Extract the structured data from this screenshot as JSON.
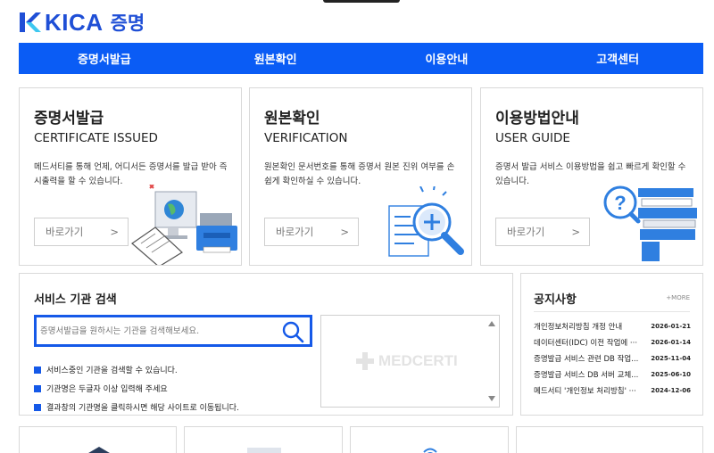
{
  "header": {
    "logo_text": "KICA",
    "logo_kor": "증명"
  },
  "nav": [
    {
      "label": "증명서발급"
    },
    {
      "label": "원본확인"
    },
    {
      "label": "이용안내"
    },
    {
      "label": "고객센터"
    }
  ],
  "cards": [
    {
      "title": "증명서발급",
      "subtitle": "CERTIFICATE ISSUED",
      "desc": "메드서티를 통해 언제, 어디서든 증명서를 발급 받아 즉시출력을 할 수 있습니다.",
      "button": "바로가기",
      "arrow": ">"
    },
    {
      "title": "원본확인",
      "subtitle": "VERIFICATION",
      "desc": "원본확인 문서번호를 통해 증명서 원본 진위 여부를 손쉽게 확인하실 수 있습니다.",
      "button": "바로가기",
      "arrow": ">"
    },
    {
      "title": "이용방법안내",
      "subtitle": "USER GUIDE",
      "desc": "증명서 발급 서비스 이용방법을 쉽고 빠르게 확인할 수 있습니다.",
      "button": "바로가기",
      "arrow": ">"
    }
  ],
  "search": {
    "title": "서비스 기관 검색",
    "placeholder": "증명서발급을 원하시는 기관을 검색해보세요.",
    "bullets": [
      "서비스중인 기관을 검색할 수 있습니다.",
      "기관명은 두글자 이상 입력해 주세요",
      "결과창의 기관명을 클릭하시면 해당 사이트로 이동됩니다."
    ],
    "watermark": "MEDCERTI"
  },
  "notice": {
    "title": "공지사항",
    "more": "+MORE",
    "items": [
      {
        "text": "개인정보처리방침 개정 안내",
        "date": "2026-01-21"
      },
      {
        "text": "데이터센터(IDC) 이전 작업에 ···",
        "date": "2026-01-14"
      },
      {
        "text": "증명발급 서비스 관련 DB 작업...",
        "date": "2025-11-04"
      },
      {
        "text": "증명발급 서비스 DB 서버 교체...",
        "date": "2025-06-10"
      },
      {
        "text": "메드서티 '개인정보 처리방침' ···",
        "date": "2024-12-06"
      }
    ]
  },
  "colors": {
    "brand": "#1f4fd6",
    "nav_bg": "#0a5cf5",
    "accent": "#1559e8"
  }
}
